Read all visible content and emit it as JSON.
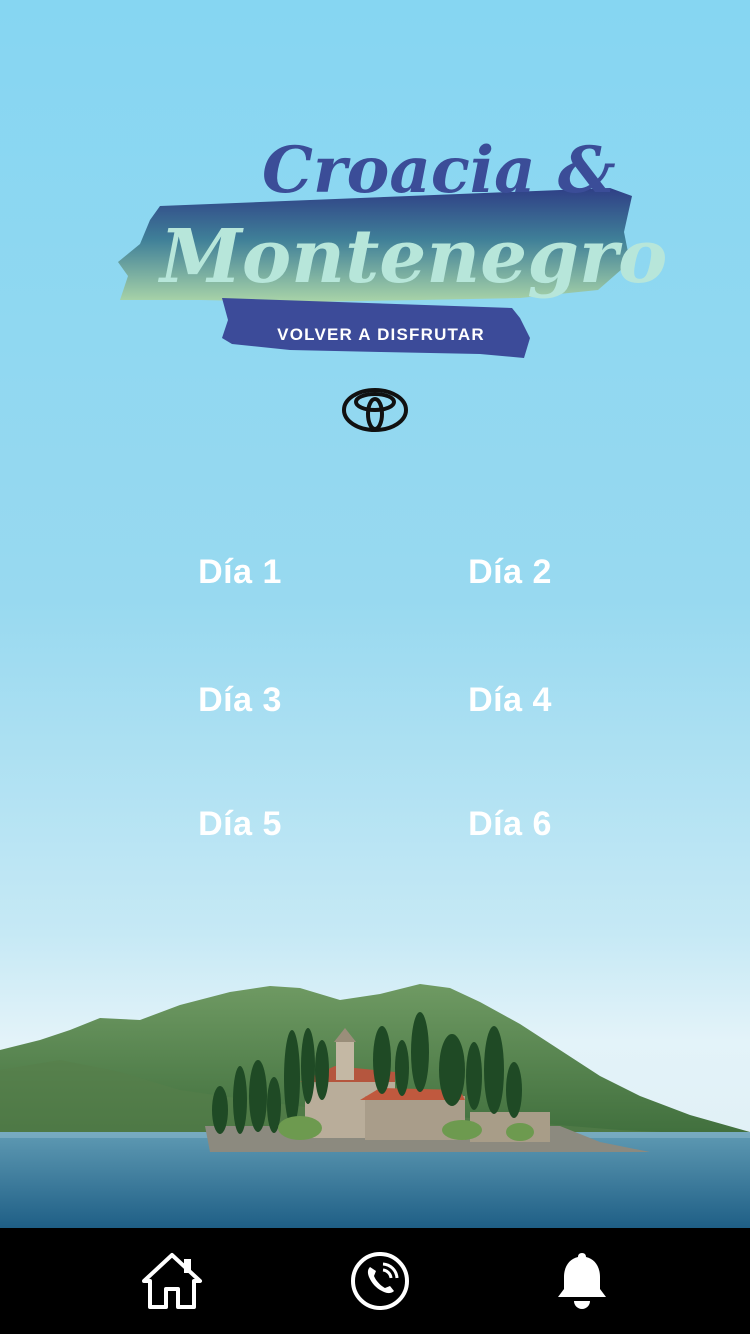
{
  "header": {
    "title_line1": "Croacia &",
    "title_line2": "Montenegro",
    "tagline": "VOLVER A DISFRUTAR",
    "brand_logo": "toyota-logo"
  },
  "days": [
    {
      "label": "Día 1",
      "color": "#3c5198"
    },
    {
      "label": "Día 2",
      "color": "#3c5198"
    },
    {
      "label": "Día 3",
      "color": "#68a89d"
    },
    {
      "label": "Día 4",
      "color": "#68a89d"
    },
    {
      "label": "Día 5",
      "color": "#a7ccb0"
    },
    {
      "label": "Día 6",
      "color": "#a7ccb0"
    }
  ],
  "tab_bar": {
    "items": [
      {
        "icon": "home-icon"
      },
      {
        "icon": "phone-icon"
      },
      {
        "icon": "bell-icon"
      }
    ]
  }
}
